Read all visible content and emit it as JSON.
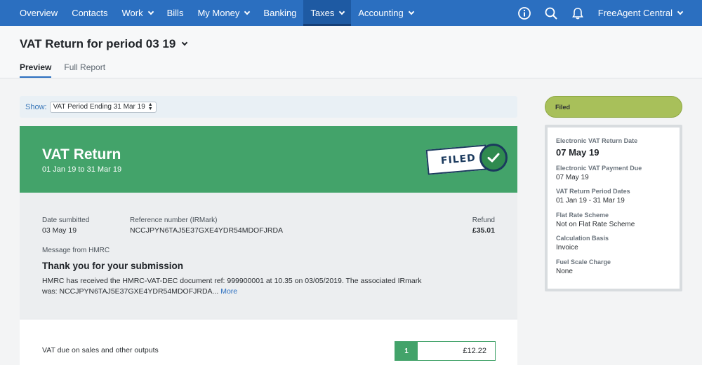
{
  "nav": {
    "items": [
      {
        "label": "Overview",
        "dropdown": false,
        "active": false
      },
      {
        "label": "Contacts",
        "dropdown": false,
        "active": false
      },
      {
        "label": "Work",
        "dropdown": true,
        "active": false
      },
      {
        "label": "Bills",
        "dropdown": false,
        "active": false
      },
      {
        "label": "My Money",
        "dropdown": true,
        "active": false
      },
      {
        "label": "Banking",
        "dropdown": false,
        "active": false
      },
      {
        "label": "Taxes",
        "dropdown": true,
        "active": true
      },
      {
        "label": "Accounting",
        "dropdown": true,
        "active": false
      }
    ],
    "icons": [
      "info-icon",
      "search-icon",
      "bell-icon"
    ],
    "account": "FreeAgent Central"
  },
  "header": {
    "title": "VAT Return for period 03 19",
    "tabs": [
      {
        "label": "Preview",
        "active": true
      },
      {
        "label": "Full Report",
        "active": false
      }
    ]
  },
  "showbar": {
    "label": "Show:",
    "selected": "VAT Period Ending 31 Mar 19"
  },
  "banner": {
    "title": "VAT Return",
    "subtitle": "01 Jan 19 to 31 Mar 19",
    "stamp": "FILED",
    "color": "#43a36a"
  },
  "details": {
    "date_label": "Date sumbitted",
    "date_value": "03 May 19",
    "ref_label": "Reference number (IRMark)",
    "ref_value": "NCCJPYN6TAJ5E37GXE4YDR54MDOFJRDA",
    "refund_label": "Refund",
    "refund_value": "£35.01",
    "message_label": "Message from HMRC",
    "message_title": "Thank you for your submission",
    "message_body": "HMRC has received the HMRC-VAT-DEC document ref: 999900001 at 10.35 on 03/05/2019. The associated IRmark was: NCCJPYN6TAJ5E37GXE4YDR54MDOFJRDA...",
    "more_link": "More"
  },
  "boxes": [
    {
      "label": "VAT due on sales and other outputs",
      "number": "1",
      "value": "£12.22"
    }
  ],
  "sidebar": {
    "status": "Filed",
    "fields": [
      {
        "label": "Electronic VAT Return Date",
        "value": "07 May 19"
      },
      {
        "label": "Electronic VAT Payment Due",
        "value": "07 May 19"
      },
      {
        "label": "VAT Return Period Dates",
        "value": "01 Jan 19 - 31 Mar 19"
      },
      {
        "label": "Flat Rate Scheme",
        "value": "Not on Flat Rate Scheme"
      },
      {
        "label": "Calculation Basis",
        "value": "Invoice"
      },
      {
        "label": "Fuel Scale Charge",
        "value": "None"
      }
    ]
  }
}
